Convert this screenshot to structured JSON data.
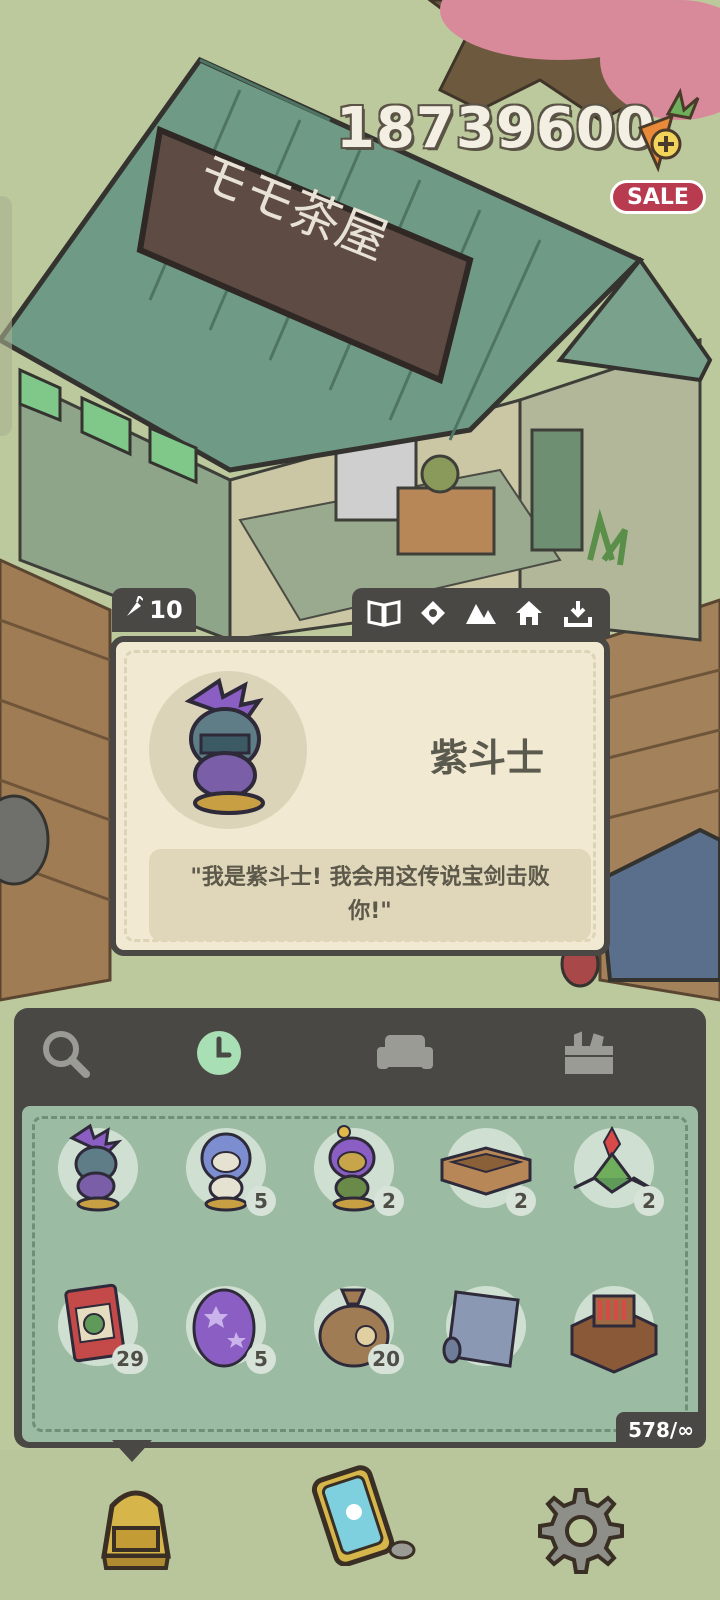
{
  "currency": {
    "amount": "18739600",
    "add_icon": "carrot-plus-icon",
    "sale_label": "SALE"
  },
  "info_card": {
    "price": "10",
    "price_icon": "carrot-icon",
    "tab_icons": [
      "book-icon",
      "tag-icon",
      "mountain-icon",
      "home-icon",
      "download-icon"
    ],
    "name": "紫斗士",
    "quote": "\"我是紫斗士! 我会用这传说宝剑击败你!\""
  },
  "inventory": {
    "tabs": [
      {
        "name": "search",
        "icon": "magnifier-icon",
        "active": false
      },
      {
        "name": "recent",
        "icon": "clock-icon",
        "active": true
      },
      {
        "name": "furniture",
        "icon": "sofa-icon",
        "active": false
      },
      {
        "name": "items",
        "icon": "box-icon",
        "active": false
      }
    ],
    "items": [
      {
        "name": "purple-fighter-figure",
        "count": ""
      },
      {
        "name": "blue-helmet-figure",
        "count": "5"
      },
      {
        "name": "frog-knight-figure",
        "count": "2"
      },
      {
        "name": "wooden-tray",
        "count": "2"
      },
      {
        "name": "bromeliad-plant",
        "count": "2"
      },
      {
        "name": "seed-packet",
        "count": "29"
      },
      {
        "name": "star-egg",
        "count": "5"
      },
      {
        "name": "money-sack",
        "count": "20"
      },
      {
        "name": "blue-rug-roll",
        "count": ""
      },
      {
        "name": "bookshelf-cart",
        "count": ""
      }
    ],
    "capacity": "578/∞"
  },
  "bottom_nav": [
    {
      "name": "backpack",
      "icon": "backpack-icon"
    },
    {
      "name": "phone",
      "icon": "phone-icon"
    },
    {
      "name": "settings",
      "icon": "gear-icon"
    }
  ],
  "colors": {
    "panel": "#4a4844",
    "grid": "#9cbba3",
    "card": "#f1e9d1",
    "sale": "#b83b4f",
    "clock_active": "#a8dfb4"
  }
}
